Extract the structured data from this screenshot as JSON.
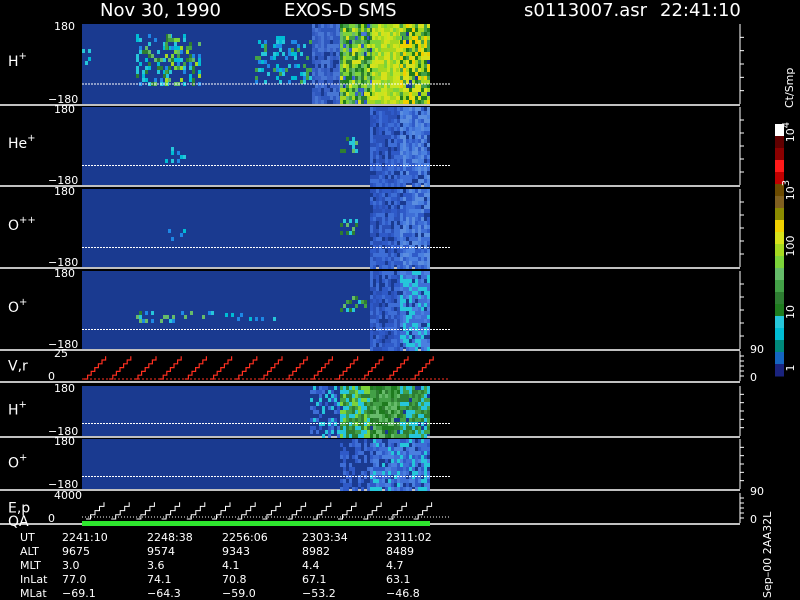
{
  "header": {
    "date": "Nov 30, 1990",
    "instrument": "EXOS-D SMS",
    "file": "s0113007.asr",
    "time": "22:41:10"
  },
  "colorbar": {
    "title": "Ct/Smp",
    "ticks": [
      {
        "text": "1",
        "sup": ""
      },
      {
        "text": "10",
        "sup": ""
      },
      {
        "text": "100",
        "sup": ""
      },
      {
        "text": "10",
        "sup": "3"
      },
      {
        "text": "10",
        "sup": "4"
      }
    ],
    "colors": [
      "#1a237e",
      "#1565c0",
      "#00897b",
      "#00bcd4",
      "#26c6da",
      "#1e7b1e",
      "#2e7d32",
      "#43a047",
      "#66bb6a",
      "#7cd33a",
      "#a5d820",
      "#d7e11b",
      "#f0d000",
      "#8b8b00",
      "#806020",
      "#6b4a00",
      "#c00000",
      "#ff1a1a",
      "#8b0000",
      "#600000",
      "#ffffff"
    ]
  },
  "panels": [
    {
      "id": "h1",
      "label": "H",
      "sup": "+",
      "top": "180",
      "bottom": "−180"
    },
    {
      "id": "he",
      "label": "He",
      "sup": "+",
      "top": "180",
      "bottom": "−180"
    },
    {
      "id": "opp",
      "label": "O",
      "sup": "++",
      "top": "180",
      "bottom": "−180"
    },
    {
      "id": "o1",
      "label": "O",
      "sup": "+",
      "top": "180",
      "bottom": "−180"
    },
    {
      "id": "vr",
      "label": "V,r",
      "sup": "",
      "top": "25",
      "bottom": "0",
      "right_top": "90",
      "right_bottom": "0"
    },
    {
      "id": "h2",
      "label": "H",
      "sup": "+",
      "top": "180",
      "bottom": "−180"
    },
    {
      "id": "o2",
      "label": "O",
      "sup": "+",
      "top": "180",
      "bottom": "−180"
    },
    {
      "id": "ep",
      "label": "E,p",
      "label2": "QA",
      "sup": "",
      "top": "4000",
      "bottom": "0",
      "right_top": "90",
      "right_bottom": "0"
    }
  ],
  "footer": {
    "row_labels": [
      "UT",
      "ALT",
      "MLT",
      "InLat",
      "MLat"
    ],
    "columns": [
      [
        "2241:10",
        "9675",
        "3.0",
        "77.0",
        "−69.1"
      ],
      [
        "2248:38",
        "9574",
        "3.6",
        "74.1",
        "−64.3"
      ],
      [
        "2256:06",
        "9343",
        "4.1",
        "70.8",
        "−59.0"
      ],
      [
        "2303:34",
        "8982",
        "4.4",
        "67.1",
        "−53.2"
      ],
      [
        "2311:02",
        "8489",
        "4.7",
        "63.1",
        "−46.8"
      ]
    ],
    "side_note": "Sep–00  2AA32L"
  },
  "chart_data": {
    "type": "heatmap",
    "title": "Nov 30, 1990    EXOS-D SMS",
    "time_ticks": [
      "2241:10",
      "2248:38",
      "2256:06",
      "2303:34",
      "2311:02"
    ],
    "colorbar_label": "Ct/Smp",
    "colorbar_range": [
      1,
      10000
    ],
    "colorbar_scale": "log",
    "panels": [
      "H+",
      "He+",
      "O++",
      "O+",
      "V,r",
      "H+",
      "O+",
      "E,p QA"
    ],
    "pitch_angle_range": [
      -180,
      180
    ]
  }
}
